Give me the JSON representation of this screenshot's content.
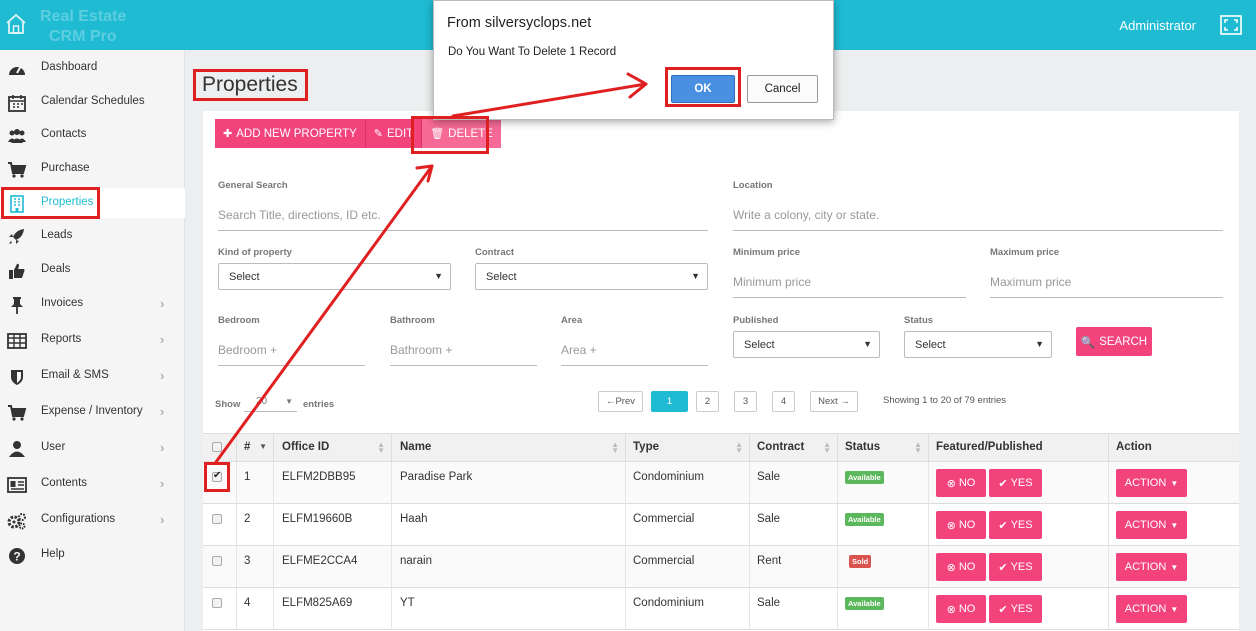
{
  "brand": {
    "line1": "Real Estate",
    "line2": "CRM Pro"
  },
  "header": {
    "user": "Administrator"
  },
  "sidebar": {
    "items": [
      {
        "label": "Dashboard",
        "icon": "dashboard-icon"
      },
      {
        "label": "Calendar Schedules",
        "icon": "calendar-icon"
      },
      {
        "label": "Contacts",
        "icon": "users-icon"
      },
      {
        "label": "Purchase",
        "icon": "cart-icon"
      },
      {
        "label": "Properties",
        "icon": "building-icon",
        "active": true
      },
      {
        "label": "Leads",
        "icon": "rocket-icon"
      },
      {
        "label": "Deals",
        "icon": "thumbs-up-icon"
      },
      {
        "label": "Invoices",
        "icon": "pin-icon"
      },
      {
        "label": "Reports",
        "icon": "table-icon"
      },
      {
        "label": "Email & SMS",
        "icon": "shield-icon"
      },
      {
        "label": "Expense / Inventory",
        "icon": "cart-icon"
      },
      {
        "label": "User",
        "icon": "user-icon"
      },
      {
        "label": "Contents",
        "icon": "id-card-icon"
      },
      {
        "label": "Configurations",
        "icon": "gears-icon"
      },
      {
        "label": "Help",
        "icon": "question-icon"
      }
    ]
  },
  "page": {
    "title": "Properties"
  },
  "toolbar": {
    "add": "ADD NEW PROPERTY",
    "edit": "EDIT",
    "delete": "DELETE"
  },
  "filters": {
    "general_search": {
      "label": "General Search",
      "placeholder": "Search Title, directions, ID etc."
    },
    "location": {
      "label": "Location",
      "placeholder": "Write a colony, city or state."
    },
    "kind": {
      "label": "Kind of property",
      "value": "Select"
    },
    "contract": {
      "label": "Contract",
      "value": "Select"
    },
    "min_price": {
      "label": "Minimum price",
      "placeholder": "Minimum price"
    },
    "max_price": {
      "label": "Maximum price",
      "placeholder": "Maximum price"
    },
    "bedroom": {
      "label": "Bedroom",
      "placeholder": "Bedroom +"
    },
    "bathroom": {
      "label": "Bathroom",
      "placeholder": "Bathroom +"
    },
    "area": {
      "label": "Area",
      "placeholder": "Area +"
    },
    "published": {
      "label": "Published",
      "value": "Select"
    },
    "status": {
      "label": "Status",
      "value": "Select"
    },
    "search_button": "SEARCH"
  },
  "listing": {
    "show": "Show",
    "page_size": "20",
    "entries": "entries",
    "pagination": {
      "prev": "←Prev",
      "pages": [
        "1",
        "2",
        "3",
        "4"
      ],
      "next": "Next →",
      "current": "1"
    },
    "showing": "Showing 1 to 20 of 79 entries"
  },
  "table": {
    "columns": [
      "#",
      "Office ID",
      "Name",
      "Type",
      "Contract",
      "Status",
      "Featured/Published",
      "Action"
    ],
    "rows": [
      {
        "num": "1",
        "office_id": "ELFM2DBB95",
        "name": "Paradise Park",
        "type": "Condominium",
        "contract": "Sale",
        "status": "Available",
        "status_color": "#5cb85c",
        "checked": true
      },
      {
        "num": "2",
        "office_id": "ELFM19660B",
        "name": "Haah",
        "type": "Commercial",
        "contract": "Sale",
        "status": "Available",
        "status_color": "#5cb85c",
        "checked": false
      },
      {
        "num": "3",
        "office_id": "ELFME2CCA4",
        "name": "narain",
        "type": "Commercial",
        "contract": "Rent",
        "status": "Sold",
        "status_color": "#d9534f",
        "checked": false
      },
      {
        "num": "4",
        "office_id": "ELFM825A69",
        "name": "YT",
        "type": "Condominium",
        "contract": "Sale",
        "status": "Available",
        "status_color": "#5cb85c",
        "checked": false
      }
    ],
    "no_label": "NO",
    "yes_label": "YES",
    "action_label": "ACTION"
  },
  "dialog": {
    "title": "From silversyclops.net",
    "message": "Do You Want To Delete 1 Record",
    "ok": "OK",
    "cancel": "Cancel"
  },
  "colors": {
    "accent": "#1ebbd3",
    "primary_button": "#f2437c",
    "annotation": "#e02020"
  }
}
